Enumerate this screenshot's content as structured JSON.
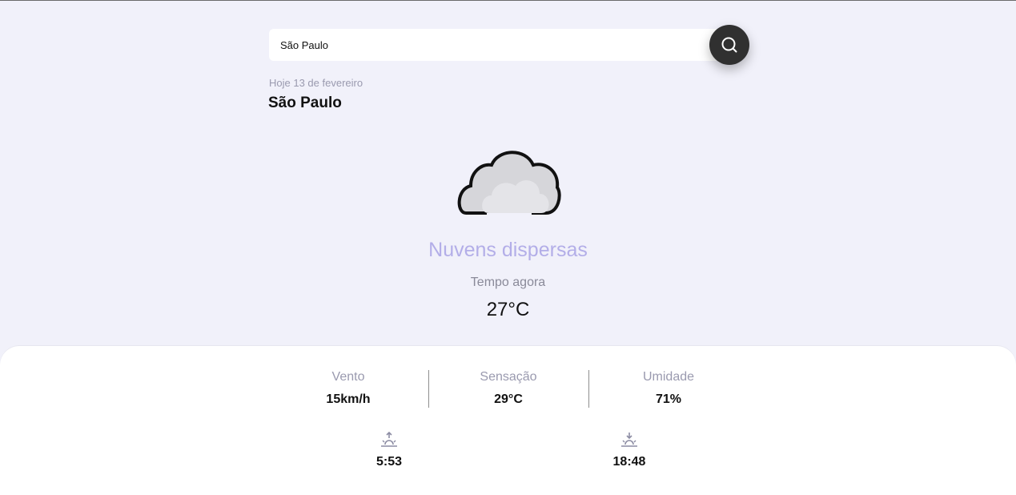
{
  "search": {
    "value": "São Paulo",
    "icon": "search-icon"
  },
  "header": {
    "date": "Hoje 13 de fevereiro",
    "city": "São Paulo"
  },
  "current": {
    "icon": "cloud-icon",
    "condition": "Nuvens dispersas",
    "label": "Tempo agora",
    "temperature": "27°C"
  },
  "details": {
    "wind": {
      "label": "Vento",
      "value": "15km/h"
    },
    "feels_like": {
      "label": "Sensação",
      "value": "29°C"
    },
    "humidity": {
      "label": "Umidade",
      "value": "71%"
    }
  },
  "sun": {
    "sunrise": {
      "icon": "sunrise-icon",
      "time": "5:53"
    },
    "sunset": {
      "icon": "sunset-icon",
      "time": "18:48"
    }
  },
  "colors": {
    "background": "#f1f1fa",
    "accent": "#b3aee8",
    "button": "#303030"
  }
}
